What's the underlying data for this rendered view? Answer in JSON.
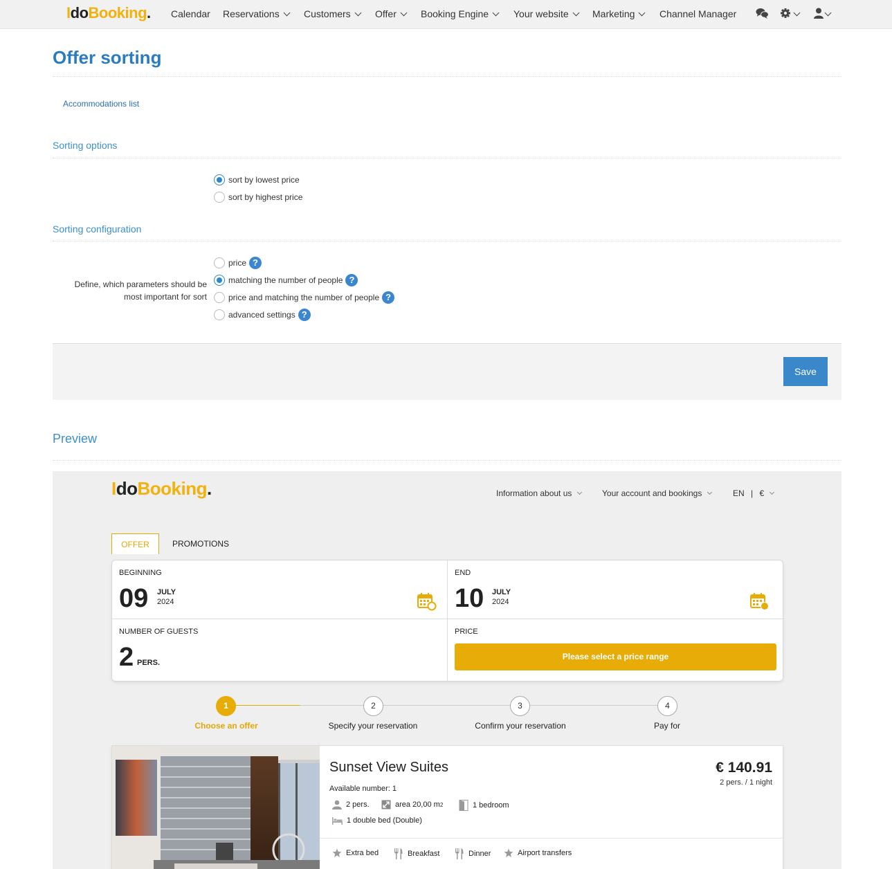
{
  "brand": {
    "i": "I",
    "do": "do",
    "booking": "Booking",
    "dot": "."
  },
  "nav": {
    "items": [
      {
        "label": "Calendar"
      },
      {
        "label": "Reservations"
      },
      {
        "label": "Customers"
      },
      {
        "label": "Offer"
      },
      {
        "label": "Booking Engine"
      },
      {
        "label": "Your website"
      },
      {
        "label": "Marketing"
      },
      {
        "label": "Channel Manager"
      }
    ],
    "icons": [
      "chat-icon",
      "gear-icon",
      "user-icon"
    ]
  },
  "page": {
    "title": "Offer sorting",
    "accommodations_link": "Accommodations list"
  },
  "sorting_options": {
    "title": "Sorting options",
    "options": [
      {
        "label": "sort by lowest price",
        "checked": true
      },
      {
        "label": "sort by highest price",
        "checked": false
      }
    ]
  },
  "sorting_config": {
    "title": "Sorting configuration",
    "field_label": "Define, which parameters should be most important for sort",
    "options": [
      {
        "label": "price",
        "checked": false
      },
      {
        "label": "matching the number of people",
        "checked": true
      },
      {
        "label": "price and matching the number of people",
        "checked": false
      },
      {
        "label": "advanced settings",
        "checked": false
      }
    ],
    "help_glyph": "?"
  },
  "save_label": "Save",
  "preview": {
    "title": "Preview",
    "menu": {
      "about": "Information about us",
      "account": "Your account and bookings",
      "lang": "EN",
      "sep": "|",
      "currency": "€"
    },
    "tabs": {
      "offer": "OFFER",
      "promotions": "PROMOTIONS"
    },
    "search": {
      "beginning_label": "BEGINNING",
      "beginning_day": "09",
      "beginning_month": "JULY",
      "beginning_year": "2024",
      "end_label": "END",
      "end_day": "10",
      "end_month": "JULY",
      "end_year": "2024",
      "guests_label": "NUMBER OF GUESTS",
      "guests_value": "2",
      "guests_unit": "PERS.",
      "price_label": "PRICE",
      "price_button": "Please select a price range"
    },
    "steps": [
      {
        "num": "1",
        "label": "Choose an offer",
        "active": true
      },
      {
        "num": "2",
        "label": "Specify your reservation",
        "active": false
      },
      {
        "num": "3",
        "label": "Confirm your reservation",
        "active": false
      },
      {
        "num": "4",
        "label": "Pay for",
        "active": false
      }
    ],
    "offer": {
      "name": "Sunset View Suites",
      "price": "€ 140.91",
      "price_sub": "2 pers. / 1 night",
      "available": "Available number: 1",
      "persons": "2 pers.",
      "area": "area 20,00 m",
      "area_sup": "2",
      "bedrooms": "1 bedroom",
      "bed": "1 double bed (Double)",
      "amenities": [
        "Extra bed",
        "Breakfast",
        "Dinner",
        "Airport transfers"
      ]
    }
  },
  "colors": {
    "accent_blue": "#2a7bbf",
    "brand_yellow": "#e8ac08",
    "save_button": "#3a88c9"
  }
}
